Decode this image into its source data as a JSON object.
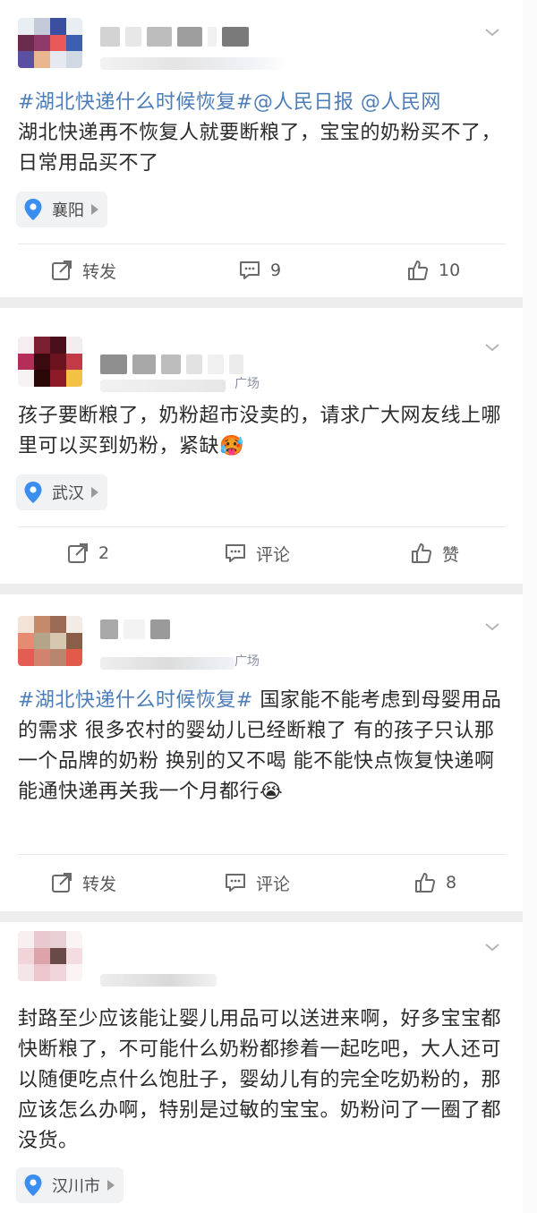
{
  "colors": {
    "topic": "#4d7db9",
    "text": "#2b2b2b",
    "muted": "#5a5a5a",
    "separator": "#ededed",
    "location_bg": "#f1f2f4"
  },
  "posts": [
    {
      "topics": [
        "#湖北快递什么时候恢复#",
        "@人民日报",
        "@人民网"
      ],
      "text": "湖北快递再不恢复人就要断粮了，宝宝的奶粉买不了，日常用品买不了",
      "location": "襄阳",
      "actions": {
        "repost": "转发",
        "comment": "9",
        "like": "10"
      }
    },
    {
      "source_suffix": "广场",
      "text": "孩子要断粮了，奶粉超市没卖的，请求广大网友线上哪里可以买到奶粉，紧缺🥵",
      "location": "武汉",
      "actions": {
        "repost": "2",
        "comment": "评论",
        "like": "赞"
      }
    },
    {
      "source_suffix": "广场",
      "topics": [
        "#湖北快递什么时候恢复#"
      ],
      "text": " 国家能不能考虑到母婴用品的需求 很多农村的婴幼儿已经断粮了 有的孩子只认那一个品牌的奶粉 换别的又不喝 能不能快点恢复快递啊 能通快递再关我一个月都行😭",
      "actions": {
        "repost": "转发",
        "comment": "评论",
        "like": "8"
      }
    },
    {
      "text": "封路至少应该能让婴儿用品可以送进来啊，好多宝宝都快断粮了，不可能什么奶粉都掺着一起吃吧，大人还可以随便吃点什么饱肚子，婴幼儿有的完全吃奶粉的，那应该怎么办啊，特别是过敏的宝宝。奶粉问了一圈了都没货。",
      "location": "汉川市"
    }
  ],
  "icons": {
    "more": "chevron-down-icon",
    "location": "location-pin-icon",
    "repost": "share-icon",
    "comment": "comment-icon",
    "like": "thumbs-up-icon"
  }
}
